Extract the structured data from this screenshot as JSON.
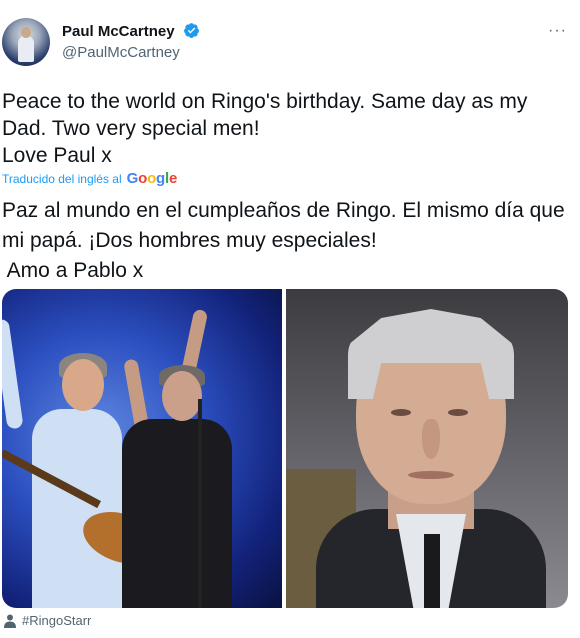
{
  "author": {
    "name": "Paul McCartney",
    "handle": "@PaulMcCartney",
    "verified": true
  },
  "menu": {
    "more_label": "···"
  },
  "tweet": {
    "lines": [
      "Peace to the world on Ringo's birthday. Same day as my Dad. Two very special men!",
      "Love Paul x"
    ]
  },
  "translation": {
    "label": "Traducido del inglés al",
    "provider_letters": [
      "G",
      "o",
      "o",
      "g",
      "l",
      "e"
    ],
    "lines": [
      "Paz al mundo en el cumpleaños de Ringo. El mismo día que mi papá. ¡Dos hombres muy especiales!",
      " Amo a Pablo x"
    ]
  },
  "media": {
    "images": [
      {
        "name": "concert-photo"
      },
      {
        "name": "portrait-photo"
      }
    ]
  },
  "tags": {
    "hashtag": "#RingoStarr"
  },
  "colors": {
    "link_blue": "#1d9bf0",
    "text_primary": "#0f1419",
    "text_secondary": "#536471",
    "verified_blue": "#1d9bf0"
  }
}
